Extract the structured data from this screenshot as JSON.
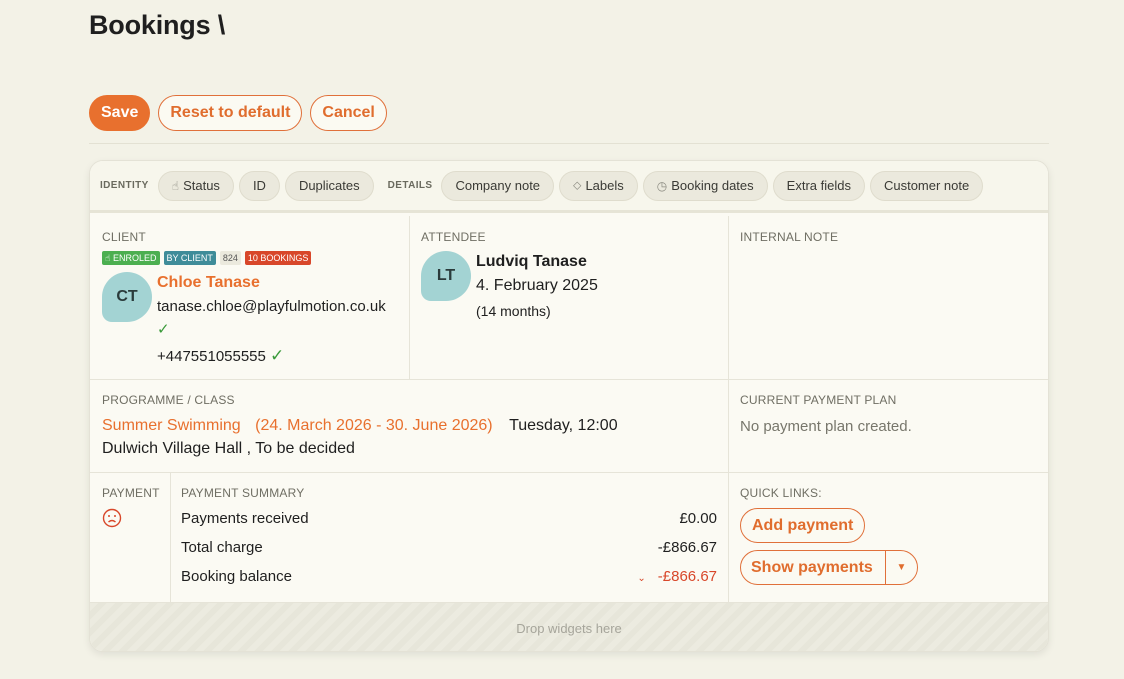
{
  "page": {
    "title": "Bookings \\"
  },
  "actions": {
    "save": "Save",
    "reset": "Reset to default",
    "cancel": "Cancel"
  },
  "chips": {
    "identity_label": "IDENTITY",
    "identity": [
      "Status",
      "ID",
      "Duplicates"
    ],
    "details_label": "DETAILS",
    "details": [
      "Company note",
      "Labels",
      "Booking dates",
      "Extra fields",
      "Customer note"
    ]
  },
  "client": {
    "label": "CLIENT",
    "badges": {
      "enroled": "ENROLED",
      "by_client": "BY CLIENT",
      "id": "824",
      "bookings": "10 BOOKINGS"
    },
    "initials": "CT",
    "name": "Chloe Tanase",
    "email": "tanase.chloe@playfulmotion.co.uk",
    "phone": "+447551055555"
  },
  "attendee": {
    "label": "ATTENDEE",
    "initials": "LT",
    "name": "Ludviq Tanase",
    "dob": "4. February 2025",
    "age": "(14 months)"
  },
  "internal_note": {
    "label": "INTERNAL NOTE"
  },
  "programme": {
    "label": "PROGRAMME / CLASS",
    "name": "Summer Swimming",
    "dates": "(24. March 2026 - 30. June 2026)",
    "schedule": "Tuesday, 12:00",
    "location": "Dulwich Village Hall , To be decided"
  },
  "payment_plan": {
    "label": "CURRENT PAYMENT PLAN",
    "text": "No payment plan created."
  },
  "payment": {
    "label": "PAYMENT"
  },
  "summary": {
    "label": "PAYMENT SUMMARY",
    "rows": [
      {
        "label": "Payments received",
        "value": "£0.00"
      },
      {
        "label": "Total charge",
        "value": "-£866.67"
      },
      {
        "label": "Booking balance",
        "value": "-£866.67"
      }
    ]
  },
  "quick_links": {
    "label": "QUICK LINKS:",
    "add_payment": "Add payment",
    "show_payments": "Show payments"
  },
  "drop": {
    "text": "Drop widgets here"
  },
  "colors": {
    "accent": "#e8702e",
    "success": "#3a9a3a",
    "danger": "#d8472a"
  }
}
